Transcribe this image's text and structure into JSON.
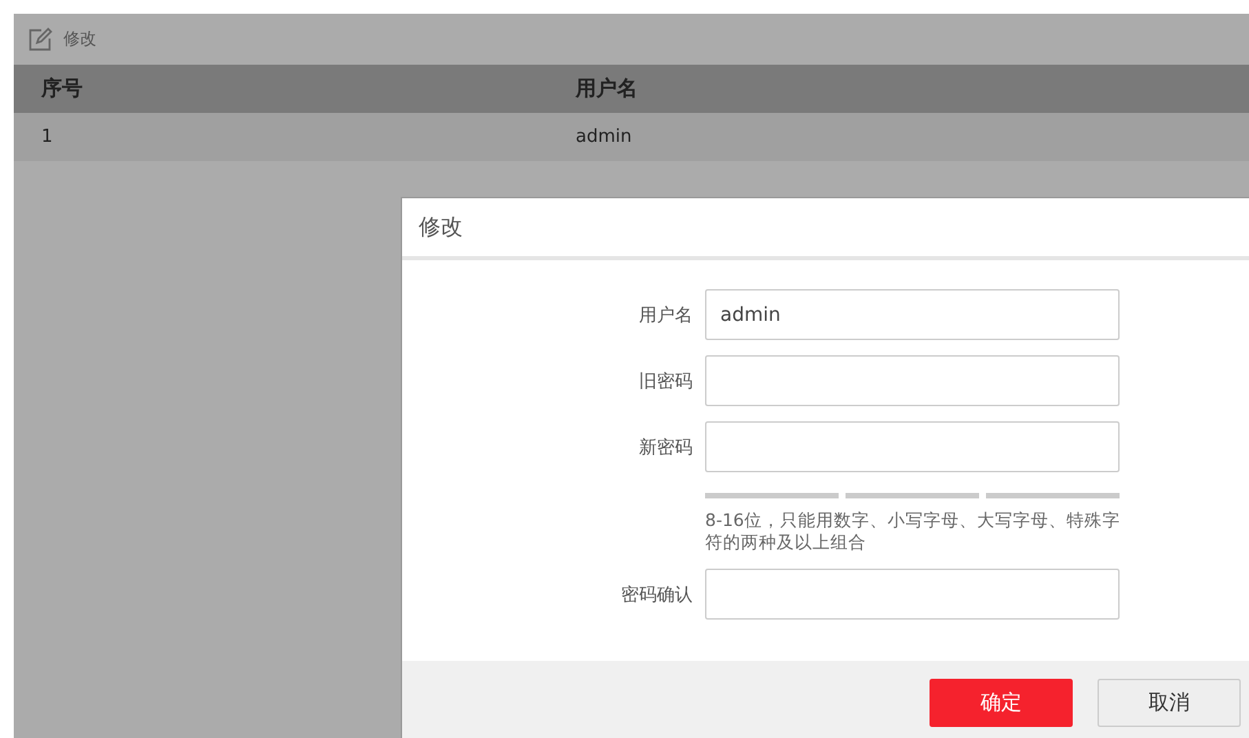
{
  "toolbar": {
    "edit_label": "修改"
  },
  "table": {
    "columns": [
      "序号",
      "用户名"
    ],
    "rows": [
      [
        "1",
        "admin"
      ]
    ]
  },
  "dialog": {
    "title": "修改",
    "fields": [
      {
        "label": "用户名",
        "value": "admin"
      },
      {
        "label": "旧密码"
      },
      {
        "label": "新密码"
      }
    ],
    "hint": "8-16位，只能用数字、小写字母、大写字母、特殊字符的两种及以上组合",
    "confirm_field": {
      "label": "密码确认"
    },
    "buttons": [
      {
        "label": "确定",
        "kind": "primary"
      },
      {
        "label": "取消",
        "kind": "secondary"
      }
    ]
  }
}
